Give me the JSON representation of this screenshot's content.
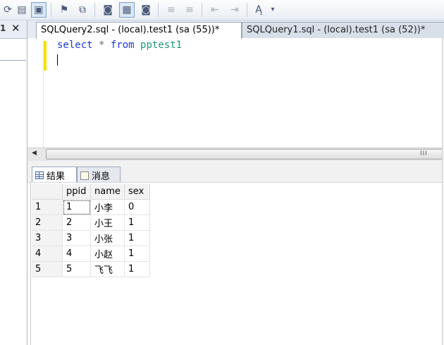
{
  "toolbar": {
    "icons": [
      "query-options-icon",
      "results-to-icon",
      "display-plan-icon",
      "include-plan-icon",
      "results-to-text-icon",
      "results-to-grid-icon",
      "results-to-file-icon",
      "comment-icon",
      "uncomment-icon",
      "decrease-indent-icon",
      "increase-indent-icon",
      "specify-values-icon"
    ]
  },
  "left_pane": {
    "pin_label": "1",
    "close_label": "✕"
  },
  "tabs": [
    {
      "label": "SQLQuery2.sql - (local).test1 (sa (55))*",
      "active": true
    },
    {
      "label": "SQLQuery1.sql - (local).test1 (sa (52))*",
      "active": false
    }
  ],
  "editor": {
    "keyword_select": "select",
    "operator_star": "*",
    "keyword_from": "from",
    "table_name": "pptest1"
  },
  "results_tabs": [
    {
      "label": "结果",
      "icon": "grid-icon",
      "active": true
    },
    {
      "label": "消息",
      "icon": "messages-icon",
      "active": false
    }
  ],
  "results_grid": {
    "columns": [
      "ppid",
      "name",
      "sex"
    ],
    "rows": [
      {
        "rownum": "1",
        "ppid": "1",
        "name": "小李",
        "sex": "0"
      },
      {
        "rownum": "2",
        "ppid": "2",
        "name": "小王",
        "sex": "1"
      },
      {
        "rownum": "3",
        "ppid": "3",
        "name": "小张",
        "sex": "1"
      },
      {
        "rownum": "4",
        "ppid": "4",
        "name": "小赵",
        "sex": "1"
      },
      {
        "rownum": "5",
        "ppid": "5",
        "name": "飞飞",
        "sex": "1"
      }
    ]
  },
  "scrollbar": {
    "grip": "III"
  }
}
